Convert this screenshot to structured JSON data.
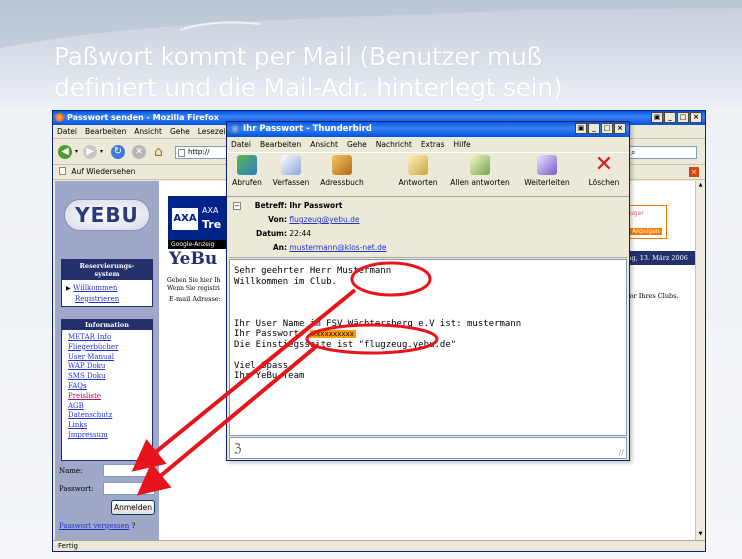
{
  "slide": {
    "title_line1": "Paßwort kommt per Mail (Benutzer muß",
    "title_line2": "definiert und die Mail-Adr. hinterlegt sein)"
  },
  "firefox": {
    "title": "Passwort senden - Mozilla Firefox",
    "menu": [
      "Datei",
      "Bearbeiten",
      "Ansicht",
      "Gehe",
      "Lesezeiche"
    ],
    "address": "http://",
    "bookmark": "Auf Wiedersehen",
    "status": "Fertig"
  },
  "page": {
    "logo": "YEBU",
    "banner_brand": "AXA",
    "banner_text_1": "AXA",
    "banner_text_2": "Tre",
    "google_ads": "Google-Anzeig",
    "heading": "YeBu",
    "right_ad_1": "uger",
    "right_ad_2": "Anzeigen",
    "date": "tag, 13. März 2006",
    "res_header": "Reservierungs-system",
    "res_links": [
      "Willkommen",
      "Registrieren"
    ],
    "intro_1": "Geben Sie hier Ih",
    "intro_2": "Wenn Sie registri",
    "email_label": "E-mail Adresse:",
    "right_text": "tor Ihres Clubs.",
    "info_header": "Information",
    "info_links": [
      "METAR Info",
      "Fliegerbücher",
      "User Manual",
      "WAP Doku",
      "SMS Doku",
      "FAQs",
      "Preisliste",
      "AGB",
      "Datenschutz",
      "Links",
      "Impressum"
    ],
    "name_label": "Name:",
    "password_label": "Passwort:",
    "login_button": "Anmelden",
    "forgot_link": "Passwort vergessen",
    "forgot_suffix": "?"
  },
  "thunderbird": {
    "title": "Ihr Passwort - Thunderbird",
    "menu": [
      "Datei",
      "Bearbeiten",
      "Ansicht",
      "Gehe",
      "Nachricht",
      "Extras",
      "Hilfe"
    ],
    "toolbar": [
      "Abrufen",
      "Verfassen",
      "Adressbuch",
      "Antworten",
      "Allen antworten",
      "Weiterleiten",
      "Löschen"
    ],
    "headers": {
      "subject_label": "Betreff:",
      "subject": "Ihr Passwort",
      "from_label": "Von:",
      "from": "flugzeug@yebu.de",
      "date_label": "Datum:",
      "date": "22:44",
      "to_label": "An:",
      "to": "mustermann@klos-net.de"
    },
    "body": {
      "greeting": "Sehr geehrter Herr Mustermann",
      "welcome": "Willkommen im Club.",
      "user_line": "Ihr User Name im FSV Wächtersberg e.V ist: mustermann",
      "password_prefix": "Ihr Passwort: ",
      "password": "xxxxxxxxxx",
      "entry_line": "Die Einstiegsseite ist \"flugzeug.yebu.de\"",
      "closing1": "Viel Spass",
      "closing2": "Ihr YeBu-Team"
    }
  },
  "colors": {
    "accent": "#0058e6",
    "highlight": "#ff9c00",
    "annotation": "#e8141c",
    "sidebar": "#9fa8c8",
    "navy": "#23306b"
  }
}
